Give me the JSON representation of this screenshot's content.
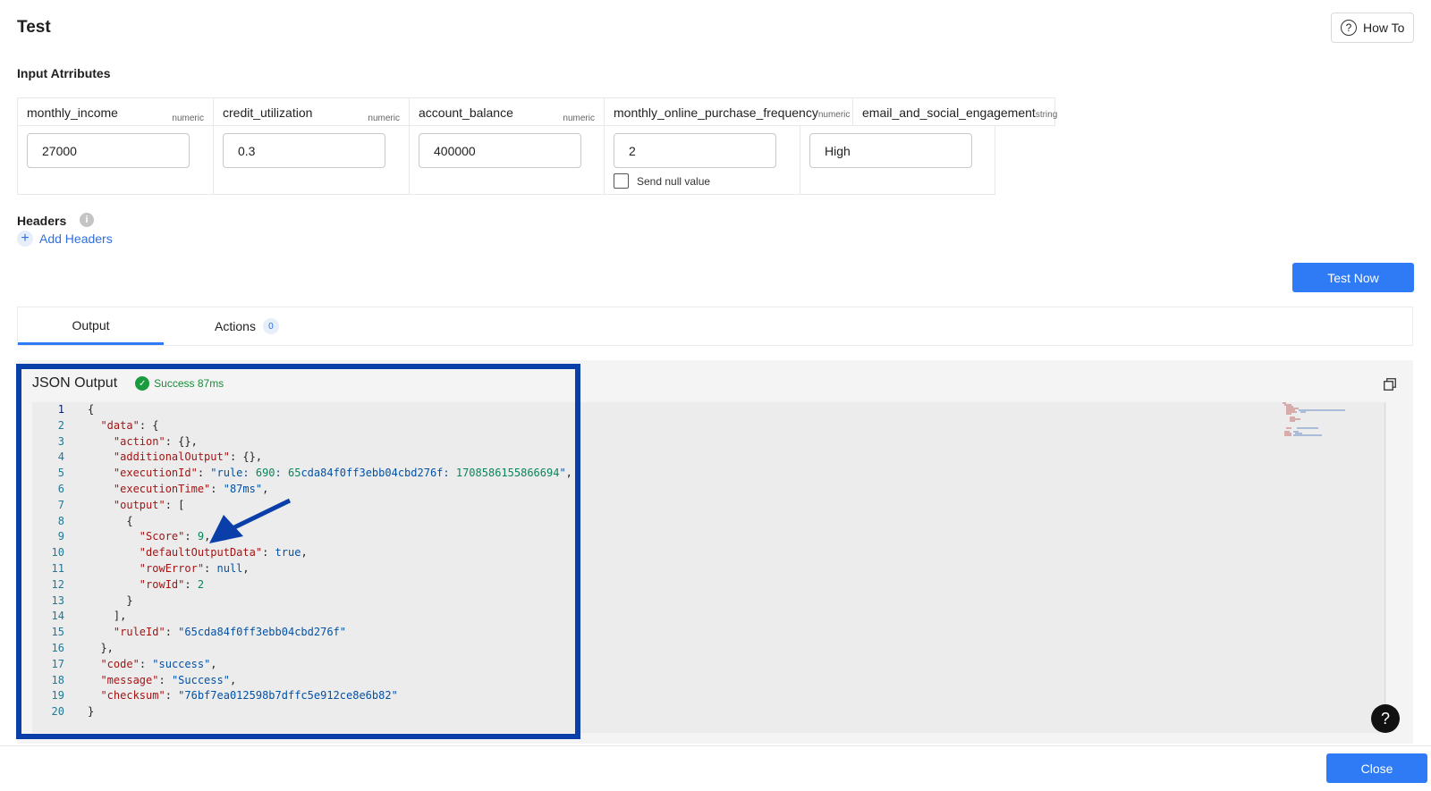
{
  "page": {
    "title": "Test",
    "how_to_label": "How To"
  },
  "input_section_label": "Input Atrributes",
  "attributes": [
    {
      "name": "monthly_income",
      "type": "numeric",
      "value": "27000"
    },
    {
      "name": "credit_utilization",
      "type": "numeric",
      "value": "0.3"
    },
    {
      "name": "account_balance",
      "type": "numeric",
      "value": "400000"
    },
    {
      "name": "monthly_online_purchase_frequency",
      "type": "numeric",
      "value": "2",
      "null_checkbox_label": "Send null value"
    },
    {
      "name": "email_and_social_engagement",
      "type": "string",
      "value": "High"
    }
  ],
  "headers": {
    "label": "Headers",
    "add_label": "Add Headers"
  },
  "test_now_label": "Test Now",
  "tabs": {
    "output_label": "Output",
    "actions_label": "Actions",
    "actions_count": "0"
  },
  "json_output": {
    "title": "JSON Output",
    "status": "Success 87ms",
    "lines": [
      {
        "n": "1",
        "text": "{"
      },
      {
        "n": "2",
        "text": "  \"data\": {"
      },
      {
        "n": "3",
        "text": "    \"action\": {},"
      },
      {
        "n": "4",
        "text": "    \"additionalOutput\": {},"
      },
      {
        "n": "5",
        "text": "    \"executionId\": \"rule:690:65cda84f0ff3ebb04cbd276f:1708586155866694\","
      },
      {
        "n": "6",
        "text": "    \"executionTime\": \"87ms\","
      },
      {
        "n": "7",
        "text": "    \"output\": ["
      },
      {
        "n": "8",
        "text": "      {"
      },
      {
        "n": "9",
        "text": "        \"Score\": 9,"
      },
      {
        "n": "10",
        "text": "        \"defaultOutputData\": true,"
      },
      {
        "n": "11",
        "text": "        \"rowError\": null,"
      },
      {
        "n": "12",
        "text": "        \"rowId\": 2"
      },
      {
        "n": "13",
        "text": "      }"
      },
      {
        "n": "14",
        "text": "    ],"
      },
      {
        "n": "15",
        "text": "    \"ruleId\": \"65cda84f0ff3ebb04cbd276f\""
      },
      {
        "n": "16",
        "text": "  },"
      },
      {
        "n": "17",
        "text": "  \"code\": \"success\","
      },
      {
        "n": "18",
        "text": "  \"message\": \"Success\","
      },
      {
        "n": "19",
        "text": "  \"checksum\": \"76bf7ea012598b7dffc5e912ce8e6b82\""
      },
      {
        "n": "20",
        "text": "}"
      }
    ]
  },
  "help_label": "?",
  "close_label": "Close",
  "colors": {
    "primary": "#2f7bf5",
    "highlight_border": "#0a3ea8",
    "success": "#1a9c3e"
  }
}
